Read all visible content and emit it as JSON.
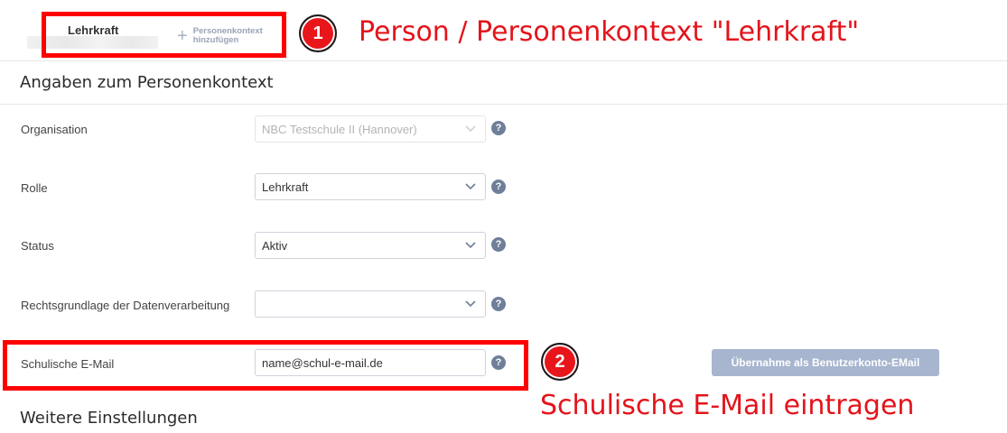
{
  "tabs": {
    "active": "Lehrkraft",
    "add_line1": "Personenkontext",
    "add_line2": "hinzufügen"
  },
  "sections": {
    "details_title": "Angaben zum Personenkontext",
    "further_title": "Weitere Einstellungen"
  },
  "form": {
    "organisation": {
      "label": "Organisation",
      "value": "NBC Testschule II (Hannover)"
    },
    "rolle": {
      "label": "Rolle",
      "value": "Lehrkraft"
    },
    "status": {
      "label": "Status",
      "value": "Aktiv"
    },
    "rechtsgrundlage": {
      "label": "Rechtsgrundlage der Datenverarbeitung",
      "value": ""
    },
    "email": {
      "label": "Schulische E-Mail",
      "value": "name@schul-e-mail.de"
    },
    "help_glyph": "?"
  },
  "buttons": {
    "take_over": "Übernahme als Benutzerkonto-EMail"
  },
  "annotations": {
    "badge1": "1",
    "callout1": "Person / Personenkontext \"Lehrkraft\"",
    "badge2": "2",
    "callout2": "Schulische E-Mail eintragen",
    "color": "#ff0000"
  }
}
